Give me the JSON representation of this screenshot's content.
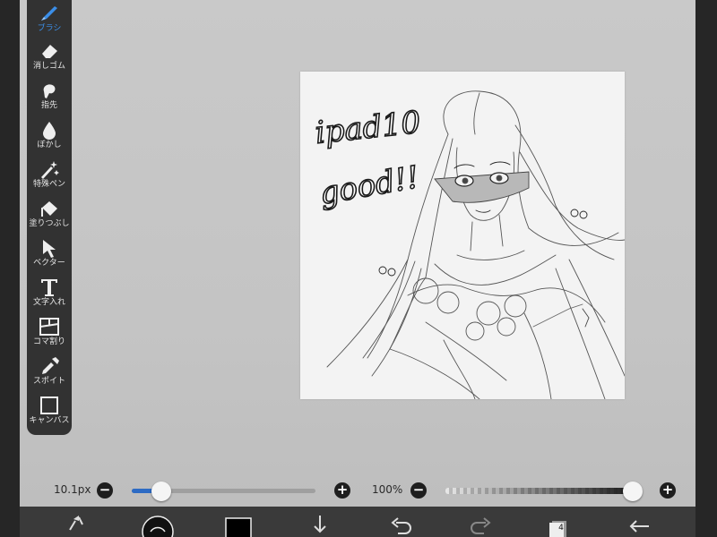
{
  "toolbar": {
    "items": [
      {
        "label": "ブラシ",
        "icon": "brush-icon",
        "active": true
      },
      {
        "label": "消しゴム",
        "icon": "eraser-icon"
      },
      {
        "label": "指先",
        "icon": "finger-icon"
      },
      {
        "label": "ぼかし",
        "icon": "blur-drop-icon"
      },
      {
        "label": "特殊ペン",
        "icon": "special-pen-icon"
      },
      {
        "label": "塗りつぶし",
        "icon": "fill-bucket-icon"
      },
      {
        "label": "ベクター",
        "icon": "vector-arrow-icon"
      },
      {
        "label": "文字入れ",
        "icon": "text-icon"
      },
      {
        "label": "コマ割り",
        "icon": "frame-divide-icon"
      },
      {
        "label": "スポイト",
        "icon": "eyedropper-icon"
      },
      {
        "label": "キャンバス",
        "icon": "canvas-icon"
      }
    ],
    "active_color": "#3b8ee8"
  },
  "canvas": {
    "handwriting_line1": "ipad10",
    "handwriting_line2": "good!!"
  },
  "sliders": {
    "brush_size": {
      "value_text": "10.1px",
      "fraction": 0.16,
      "minus": "−",
      "plus": "+"
    },
    "opacity": {
      "value_text": "100%",
      "fraction": 1.0,
      "minus": "−",
      "plus": "+"
    }
  },
  "bottom_toolbar": {
    "items": [
      "transform-icon",
      "brush-preview-icon",
      "color-swatch-icon",
      "download-icon",
      "undo-icon",
      "redo-icon",
      "layers-icon",
      "back-icon"
    ],
    "layers_count": "4",
    "color_swatch": "#000000"
  },
  "colors": {
    "accent": "#2d6bc4",
    "toolbar_bg": "#323232",
    "screen_bg": "#c6c6c6"
  }
}
